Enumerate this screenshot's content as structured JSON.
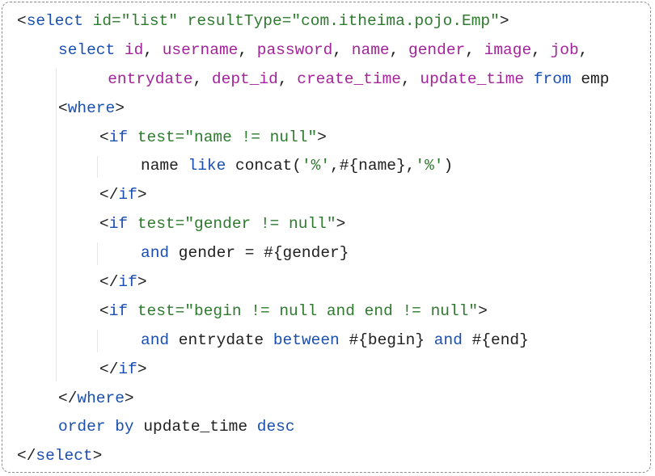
{
  "code_lines": [
    {
      "indent": 0,
      "tokens": [
        {
          "t": "<",
          "c": "txt"
        },
        {
          "t": "select",
          "c": "tag"
        },
        {
          "t": " ",
          "c": "txt"
        },
        {
          "t": "id=",
          "c": "attr"
        },
        {
          "t": "\"list\"",
          "c": "str"
        },
        {
          "t": " ",
          "c": "txt"
        },
        {
          "t": "resultType=",
          "c": "attr"
        },
        {
          "t": "\"com.itheima.pojo.Emp\"",
          "c": "str"
        },
        {
          "t": ">",
          "c": "txt"
        }
      ]
    },
    {
      "indent": 1,
      "tokens": [
        {
          "t": "select",
          "c": "kw"
        },
        {
          "t": " ",
          "c": "txt"
        },
        {
          "t": "id",
          "c": "col"
        },
        {
          "t": ", ",
          "c": "txt"
        },
        {
          "t": "username",
          "c": "col"
        },
        {
          "t": ", ",
          "c": "txt"
        },
        {
          "t": "password",
          "c": "col"
        },
        {
          "t": ", ",
          "c": "txt"
        },
        {
          "t": "name",
          "c": "col"
        },
        {
          "t": ", ",
          "c": "txt"
        },
        {
          "t": "gender",
          "c": "col"
        },
        {
          "t": ", ",
          "c": "txt"
        },
        {
          "t": "image",
          "c": "col"
        },
        {
          "t": ", ",
          "c": "txt"
        },
        {
          "t": "job",
          "c": "col"
        },
        {
          "t": ",",
          "c": "txt"
        }
      ]
    },
    {
      "indent": 2.2,
      "tokens": [
        {
          "t": "entrydate",
          "c": "col"
        },
        {
          "t": ", ",
          "c": "txt"
        },
        {
          "t": "dept_id",
          "c": "col"
        },
        {
          "t": ", ",
          "c": "txt"
        },
        {
          "t": "create_time",
          "c": "col"
        },
        {
          "t": ", ",
          "c": "txt"
        },
        {
          "t": "update_time",
          "c": "col"
        },
        {
          "t": " ",
          "c": "txt"
        },
        {
          "t": "from",
          "c": "kw"
        },
        {
          "t": " ",
          "c": "txt"
        },
        {
          "t": "emp",
          "c": "txt"
        }
      ]
    },
    {
      "indent": 1,
      "tokens": [
        {
          "t": "<",
          "c": "txt"
        },
        {
          "t": "where",
          "c": "tag"
        },
        {
          "t": ">",
          "c": "txt"
        }
      ]
    },
    {
      "indent": 2,
      "tokens": [
        {
          "t": "<",
          "c": "txt"
        },
        {
          "t": "if",
          "c": "tag"
        },
        {
          "t": " ",
          "c": "txt"
        },
        {
          "t": "test=",
          "c": "attr"
        },
        {
          "t": "\"name != null\"",
          "c": "str"
        },
        {
          "t": ">",
          "c": "txt"
        }
      ]
    },
    {
      "indent": 3,
      "tokens": [
        {
          "t": "name",
          "c": "txt"
        },
        {
          "t": " ",
          "c": "txt"
        },
        {
          "t": "like",
          "c": "kw"
        },
        {
          "t": " ",
          "c": "txt"
        },
        {
          "t": "concat(",
          "c": "txt"
        },
        {
          "t": "'%'",
          "c": "str"
        },
        {
          "t": ",#{name},",
          "c": "txt"
        },
        {
          "t": "'%'",
          "c": "str"
        },
        {
          "t": ")",
          "c": "txt"
        }
      ]
    },
    {
      "indent": 2,
      "tokens": [
        {
          "t": "</",
          "c": "txt"
        },
        {
          "t": "if",
          "c": "tag"
        },
        {
          "t": ">",
          "c": "txt"
        }
      ]
    },
    {
      "indent": 2,
      "tokens": [
        {
          "t": "<",
          "c": "txt"
        },
        {
          "t": "if",
          "c": "tag"
        },
        {
          "t": " ",
          "c": "txt"
        },
        {
          "t": "test=",
          "c": "attr"
        },
        {
          "t": "\"gender != null\"",
          "c": "str"
        },
        {
          "t": ">",
          "c": "txt"
        }
      ]
    },
    {
      "indent": 3,
      "tokens": [
        {
          "t": "and",
          "c": "kw"
        },
        {
          "t": " gender = #{gender}",
          "c": "txt"
        }
      ]
    },
    {
      "indent": 2,
      "tokens": [
        {
          "t": "</",
          "c": "txt"
        },
        {
          "t": "if",
          "c": "tag"
        },
        {
          "t": ">",
          "c": "txt"
        }
      ]
    },
    {
      "indent": 2,
      "tokens": [
        {
          "t": "<",
          "c": "txt"
        },
        {
          "t": "if",
          "c": "tag"
        },
        {
          "t": " ",
          "c": "txt"
        },
        {
          "t": "test=",
          "c": "attr"
        },
        {
          "t": "\"begin != null and end != null\"",
          "c": "str"
        },
        {
          "t": ">",
          "c": "txt"
        }
      ]
    },
    {
      "indent": 3,
      "tokens": [
        {
          "t": "and",
          "c": "kw"
        },
        {
          "t": " entrydate ",
          "c": "txt"
        },
        {
          "t": "between",
          "c": "kw"
        },
        {
          "t": " #{begin} ",
          "c": "txt"
        },
        {
          "t": "and",
          "c": "kw"
        },
        {
          "t": " #{end}",
          "c": "txt"
        }
      ]
    },
    {
      "indent": 2,
      "tokens": [
        {
          "t": "</",
          "c": "txt"
        },
        {
          "t": "if",
          "c": "tag"
        },
        {
          "t": ">",
          "c": "txt"
        }
      ]
    },
    {
      "indent": 1,
      "tokens": [
        {
          "t": "</",
          "c": "txt"
        },
        {
          "t": "where",
          "c": "tag"
        },
        {
          "t": ">",
          "c": "txt"
        }
      ]
    },
    {
      "indent": 1,
      "tokens": [
        {
          "t": "order by",
          "c": "kw"
        },
        {
          "t": " update_time ",
          "c": "txt"
        },
        {
          "t": "desc",
          "c": "kw"
        }
      ]
    },
    {
      "indent": 0,
      "tokens": [
        {
          "t": "</",
          "c": "txt"
        },
        {
          "t": "select",
          "c": "tag"
        },
        {
          "t": ">",
          "c": "txt"
        }
      ]
    }
  ],
  "colors": {
    "tag": "#1a4fb0",
    "keyword": "#1a4fb0",
    "attribute": "#2e7a2e",
    "string": "#2e7a2e",
    "column": "#a3249a",
    "text": "#202020",
    "border": "#8c8c8c"
  }
}
